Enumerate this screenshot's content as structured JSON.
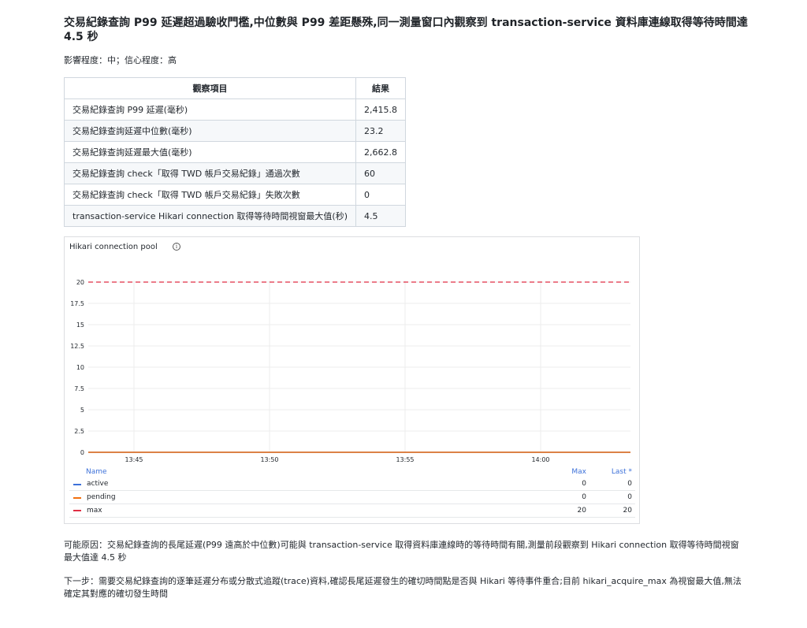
{
  "title": "交易紀錄查詢 P99 延遲超過驗收門檻,中位數與 P99 差距懸殊,同一測量窗口內觀察到 transaction-service 資料庫連線取得等待時間達 4.5 秒",
  "meta": "影響程度：中；信心程度：高",
  "table": {
    "headers": [
      "觀察項目",
      "結果"
    ],
    "rows": [
      {
        "item": "交易紀錄查詢 P99 延遲(毫秒)",
        "result": "2,415.8"
      },
      {
        "item": "交易紀錄查詢延遲中位數(毫秒)",
        "result": "23.2"
      },
      {
        "item": "交易紀錄查詢延遲最大值(毫秒)",
        "result": "2,662.8"
      },
      {
        "item": "交易紀錄查詢 check「取得 TWD 帳戶交易紀錄」通過次數",
        "result": "60"
      },
      {
        "item": "交易紀錄查詢 check「取得 TWD 帳戶交易紀錄」失敗次數",
        "result": "0"
      },
      {
        "item": "transaction-service Hikari connection 取得等待時間視窗最大值(秒)",
        "result": "4.5"
      }
    ]
  },
  "panel": {
    "title": "Hikari connection pool",
    "info_icon": "info-icon",
    "legend": {
      "header_name": "Name",
      "header_max": "Max",
      "header_last": "Last *",
      "items": [
        {
          "name": "active",
          "max": "0",
          "last": "0",
          "color": "#3d71d9",
          "style": "solid"
        },
        {
          "name": "pending",
          "max": "0",
          "last": "0",
          "color": "#f2700f",
          "style": "solid"
        },
        {
          "name": "max",
          "max": "20",
          "last": "20",
          "color": "#e02f44",
          "style": "dashed"
        }
      ]
    }
  },
  "chart_data": {
    "type": "line",
    "title": "Hikari connection pool",
    "x_ticks": [
      "13:45",
      "13:50",
      "13:55",
      "14:00"
    ],
    "y_ticks": [
      "0",
      "2.5",
      "5",
      "7.5",
      "10",
      "12.5",
      "15",
      "17.5",
      "20"
    ],
    "ylim": [
      0,
      20
    ],
    "grid": true,
    "legend_placement": "bottom",
    "series": [
      {
        "name": "active",
        "values": [
          0,
          0
        ],
        "color": "#3d71d9",
        "style": "solid"
      },
      {
        "name": "pending",
        "values": [
          0,
          0
        ],
        "color": "#f2700f",
        "style": "solid"
      },
      {
        "name": "max",
        "values": [
          20,
          20
        ],
        "color": "#e02f44",
        "style": "dashed"
      }
    ]
  },
  "cause": "可能原因：交易紀錄查詢的長尾延遲(P99 遠高於中位數)可能與 transaction-service 取得資料庫連線時的等待時間有關,測量前段觀察到 Hikari connection 取得等待時間視窗最大值達 4.5 秒",
  "next_step": "下一步：需要交易紀錄查詢的逐筆延遲分布或分散式追蹤(trace)資料,確認長尾延遲發生的確切時間點是否與 Hikari 等待事件重合;目前 hikari_acquire_max 為視窗最大值,無法確定其對應的確切發生時間"
}
